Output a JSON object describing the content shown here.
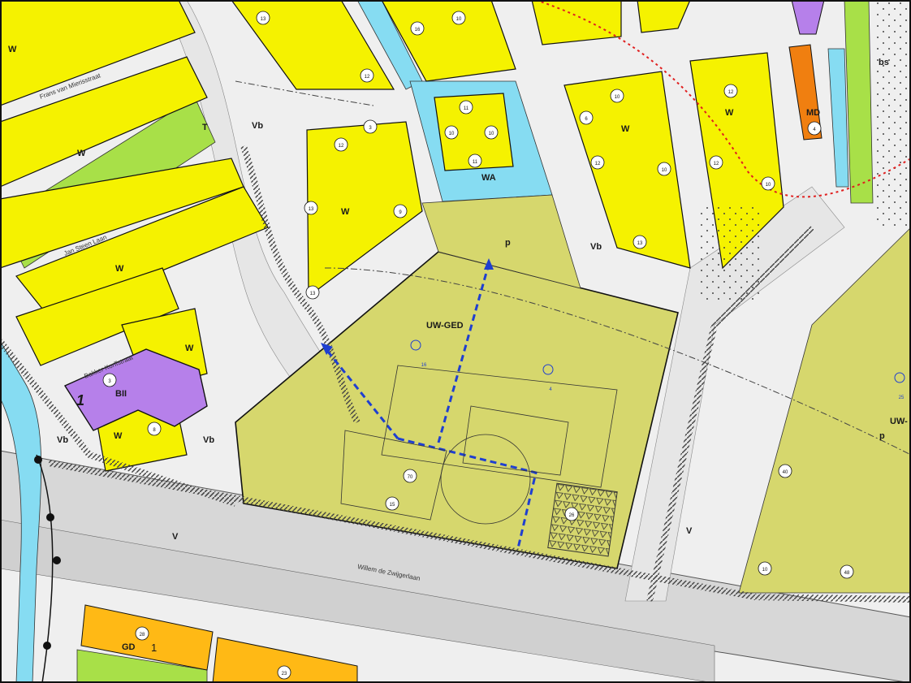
{
  "colors": {
    "wonen": "#f5f200",
    "water": "#86dcf2",
    "groen": "#a8e048",
    "bijzonder": "#b680ea",
    "maatschappelijk": "#f07f10",
    "bedrijf": "#ffb915",
    "uitwerking": "#d6d76d",
    "road": "#d7d7d7",
    "arrow": "#1f3fd0",
    "boundary": "#e02020"
  },
  "zone_labels": {
    "w1": "W",
    "w2": "W",
    "w3": "W",
    "w4": "W",
    "w5": "W",
    "w6": "W",
    "w7": "W",
    "w8": "W",
    "w9": "W",
    "t": "T",
    "vb1": "Vb",
    "vb2": "Vb",
    "vb3": "Vb",
    "vb4": "Vb",
    "wa": "WA",
    "p1": "p",
    "p2": "p",
    "uwged": "UW-GED",
    "uw": "UW-",
    "bii": "BII",
    "v1": "V",
    "v2": "V",
    "md": "MD",
    "bs": "bs",
    "gd": "GD",
    "gd_num": "1",
    "bii_num": "1"
  },
  "street_labels": {
    "s1": "Frans van Mierisstraat",
    "s2": "Jan Steen Laan",
    "s3": "Bakker Korffstraat",
    "s4": "Willem de Zwijgerlaan"
  },
  "heights": {
    "h13a": "13",
    "h12a": "12",
    "h16": "16",
    "h10a": "10",
    "h12b": "12",
    "h3a": "3",
    "h3b": "3",
    "h9": "9",
    "h8a": "8",
    "h13b": "13",
    "h8b": "8",
    "h10b": "10",
    "h11a": "11",
    "h10c": "10",
    "h12c": "12",
    "h11b": "11",
    "h6": "6",
    "h10d": "10",
    "h12d": "12",
    "h10e": "10",
    "h13c": "13",
    "h10f": "10",
    "h12e": "12",
    "h13d": "13",
    "h10g": "10",
    "h3c": "3",
    "h8c": "8",
    "h10h": "10",
    "h70": "70",
    "h15": "15",
    "h26": "26",
    "h4": "4",
    "h40": "40",
    "h28": "28",
    "h23": "23",
    "h16b": "16",
    "h4b": "4",
    "h25": "25",
    "h48": "48"
  }
}
